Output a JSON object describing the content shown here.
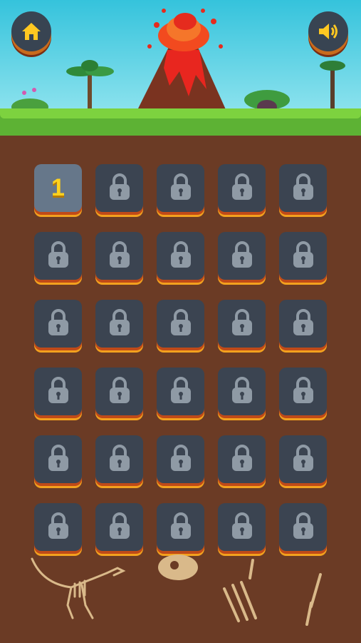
{
  "header": {
    "home_icon": "home-icon",
    "sound_icon": "speaker-icon"
  },
  "levels": [
    {
      "label": "1",
      "locked": false
    },
    {
      "label": "",
      "locked": true
    },
    {
      "label": "",
      "locked": true
    },
    {
      "label": "",
      "locked": true
    },
    {
      "label": "",
      "locked": true
    },
    {
      "label": "",
      "locked": true
    },
    {
      "label": "",
      "locked": true
    },
    {
      "label": "",
      "locked": true
    },
    {
      "label": "",
      "locked": true
    },
    {
      "label": "",
      "locked": true
    },
    {
      "label": "",
      "locked": true
    },
    {
      "label": "",
      "locked": true
    },
    {
      "label": "",
      "locked": true
    },
    {
      "label": "",
      "locked": true
    },
    {
      "label": "",
      "locked": true
    },
    {
      "label": "",
      "locked": true
    },
    {
      "label": "",
      "locked": true
    },
    {
      "label": "",
      "locked": true
    },
    {
      "label": "",
      "locked": true
    },
    {
      "label": "",
      "locked": true
    },
    {
      "label": "",
      "locked": true
    },
    {
      "label": "",
      "locked": true
    },
    {
      "label": "",
      "locked": true
    },
    {
      "label": "",
      "locked": true
    },
    {
      "label": "",
      "locked": true
    },
    {
      "label": "",
      "locked": true
    },
    {
      "label": "",
      "locked": true
    },
    {
      "label": "",
      "locked": true
    },
    {
      "label": "",
      "locked": true
    },
    {
      "label": "",
      "locked": true
    }
  ],
  "colors": {
    "sky": "#35c3dc",
    "grass": "#5db234",
    "soil": "#6b3b25",
    "tile": "#3b4451",
    "tile_unlocked": "#66778a",
    "number": "#ffd21d",
    "lava": "#f3a11e"
  }
}
